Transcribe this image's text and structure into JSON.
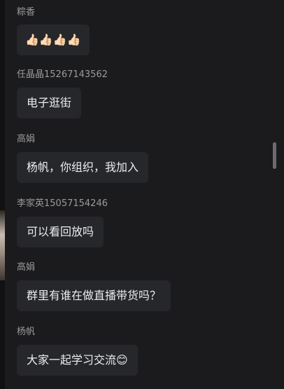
{
  "messages": [
    {
      "sender": "粽香",
      "text": "",
      "emojis": [
        "👍🏻",
        "👍🏻",
        "👍🏻",
        "👍🏻"
      ]
    },
    {
      "sender": "任晶晶15267143562",
      "text": "电子逛街"
    },
    {
      "sender": "高娟",
      "text": "杨帆，你组织，我加入"
    },
    {
      "sender": "李家英15057154246",
      "text": "可以看回放吗"
    },
    {
      "sender": "高娟",
      "text": "群里有谁在做直播带货吗？"
    },
    {
      "sender": "杨帆",
      "text": "大家一起学习交流",
      "emoji_suffix": "😊"
    }
  ]
}
